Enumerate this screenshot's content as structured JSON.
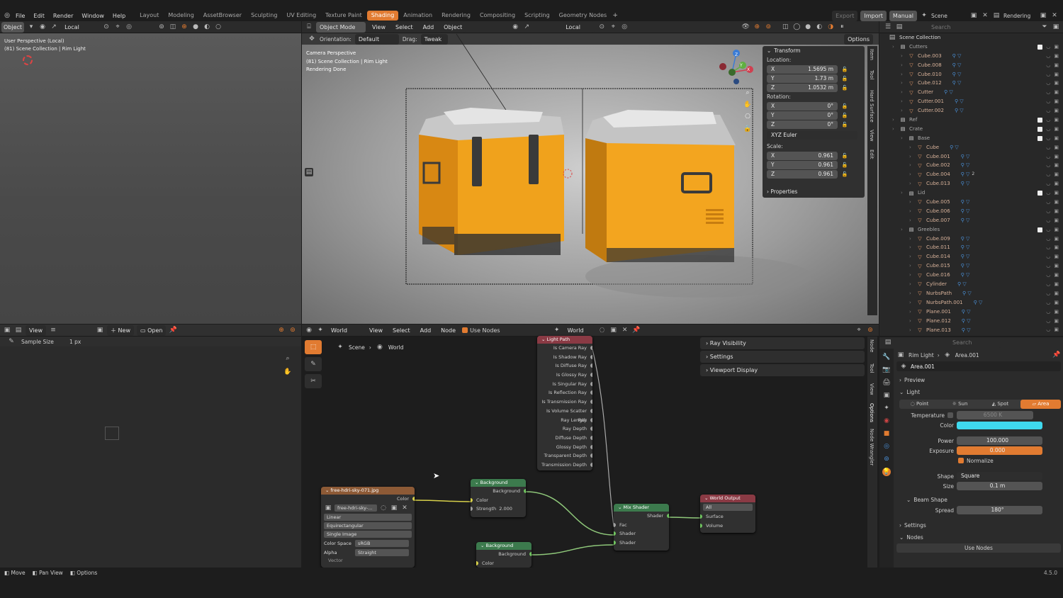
{
  "topbar": {
    "menus": [
      "File",
      "Edit",
      "Render",
      "Window",
      "Help"
    ],
    "workspaces": [
      "Layout",
      "Modeling",
      "AssetBrowser",
      "Sculpting",
      "UV Editing",
      "Texture Paint",
      "Shading",
      "Animation",
      "Rendering",
      "Compositing",
      "Scripting",
      "Geometry Nodes"
    ],
    "active_workspace": "Shading",
    "right": {
      "export": "Export",
      "import": "Import",
      "manual": "Manual",
      "scene": "Scene",
      "view_layer": "Rendering"
    }
  },
  "left_viewport": {
    "header": {
      "mode": "Object",
      "orientation": "Local"
    },
    "overlay_line1": "User Perspective (Local)",
    "overlay_line2": "(81) Scene Collection | Rim Light"
  },
  "main_viewport": {
    "header": {
      "mode": "Object Mode",
      "menus": [
        "View",
        "Select",
        "Add",
        "Object"
      ],
      "orientation": "Local",
      "options": "Options"
    },
    "tool_header": {
      "orientation_label": "Orientation:",
      "orientation_value": "Default",
      "drag_label": "Drag:",
      "drag_value": "Tweak"
    },
    "overlay_line1": "Camera Perspective",
    "overlay_line2": "(81) Scene Collection | Rim Light",
    "overlay_line3": "Rendering Done",
    "side_tabs": [
      "Item",
      "Tool",
      "Hard Surface",
      "View",
      "Edit"
    ],
    "gizmo": {
      "x": "X",
      "y": "Y",
      "z": "Z"
    }
  },
  "transform": {
    "title": "Transform",
    "location_label": "Location:",
    "location": [
      {
        "axis": "X",
        "value": "1.5695 m"
      },
      {
        "axis": "Y",
        "value": "1.73 m"
      },
      {
        "axis": "Z",
        "value": "1.0532 m"
      }
    ],
    "rotation_label": "Rotation:",
    "rotation": [
      {
        "axis": "X",
        "value": "0°"
      },
      {
        "axis": "Y",
        "value": "0°"
      },
      {
        "axis": "Z",
        "value": "0°"
      }
    ],
    "rotation_mode": "XYZ Euler",
    "scale_label": "Scale:",
    "scale": [
      {
        "axis": "X",
        "value": "0.961"
      },
      {
        "axis": "Y",
        "value": "0.961"
      },
      {
        "axis": "Z",
        "value": "0.961"
      }
    ],
    "properties": "Properties"
  },
  "outliner": {
    "search_placeholder": "Search",
    "root": "Scene Collection",
    "rows": [
      {
        "name": "Cutters",
        "type": "coll",
        "indent": 1
      },
      {
        "name": "Cube.003",
        "type": "obj",
        "indent": 2
      },
      {
        "name": "Cube.008",
        "type": "obj",
        "indent": 2
      },
      {
        "name": "Cube.010",
        "type": "obj",
        "indent": 2
      },
      {
        "name": "Cube.012",
        "type": "obj",
        "indent": 2
      },
      {
        "name": "Cutter",
        "type": "obj",
        "indent": 2
      },
      {
        "name": "Cutter.001",
        "type": "obj",
        "indent": 2
      },
      {
        "name": "Cutter.002",
        "type": "obj",
        "indent": 2
      },
      {
        "name": "Ref",
        "type": "ref",
        "indent": 1
      },
      {
        "name": "Crate",
        "type": "coll",
        "indent": 1
      },
      {
        "name": "Base",
        "type": "coll",
        "indent": 2
      },
      {
        "name": "Cube",
        "type": "obj",
        "indent": 3
      },
      {
        "name": "Cube.001",
        "type": "obj",
        "indent": 3
      },
      {
        "name": "Cube.002",
        "type": "obj",
        "indent": 3
      },
      {
        "name": "Cube.004",
        "type": "obj",
        "indent": 3
      },
      {
        "name": "Cube.013",
        "type": "obj",
        "indent": 3
      },
      {
        "name": "Lid",
        "type": "coll",
        "indent": 2
      },
      {
        "name": "Cube.005",
        "type": "obj",
        "indent": 3
      },
      {
        "name": "Cube.006",
        "type": "obj",
        "indent": 3
      },
      {
        "name": "Cube.007",
        "type": "obj",
        "indent": 3
      },
      {
        "name": "Greebles",
        "type": "coll",
        "indent": 2
      },
      {
        "name": "Cube.009",
        "type": "obj",
        "indent": 3
      },
      {
        "name": "Cube.011",
        "type": "obj",
        "indent": 3
      },
      {
        "name": "Cube.014",
        "type": "obj",
        "indent": 3
      },
      {
        "name": "Cube.015",
        "type": "obj",
        "indent": 3
      },
      {
        "name": "Cube.016",
        "type": "obj",
        "indent": 3
      },
      {
        "name": "Cylinder",
        "type": "obj",
        "indent": 3
      },
      {
        "name": "NurbsPath",
        "type": "obj",
        "indent": 3
      },
      {
        "name": "NurbsPath.001",
        "type": "obj",
        "indent": 3
      },
      {
        "name": "Plane.001",
        "type": "obj",
        "indent": 3
      },
      {
        "name": "Plane.012",
        "type": "obj",
        "indent": 3
      },
      {
        "name": "Plane.013",
        "type": "obj",
        "indent": 3
      }
    ],
    "badge_cube004": "2"
  },
  "image_editor": {
    "menus": [
      "View"
    ],
    "new": "New",
    "open": "Open",
    "sample_size_label": "Sample Size",
    "sample_size_value": "1 px"
  },
  "node_editor": {
    "world": "World",
    "menus": [
      "View",
      "Select",
      "Add",
      "Node"
    ],
    "use_nodes": "Use Nodes",
    "world_slot": "World",
    "breadcrumb_scene": "Scene",
    "breadcrumb_world": "World",
    "side_panels": [
      "Ray Visibility",
      "Settings",
      "Viewport Display"
    ],
    "side_tabs": [
      "Node",
      "Tool",
      "View",
      "Options",
      "Node Wrangler"
    ]
  },
  "nodes": {
    "light_path": {
      "title": "Light Path",
      "outputs": [
        "Is Camera Ray",
        "Is Shadow Ray",
        "Is Diffuse Ray",
        "Is Glossy Ray",
        "Is Singular Ray",
        "Is Reflection Ray",
        "Is Transmission Ray",
        "Is Volume Scatter Ray",
        "Ray Length",
        "Ray Depth",
        "Diffuse Depth",
        "Glossy Depth",
        "Transparent Depth",
        "Transmission Depth"
      ]
    },
    "image_tex": {
      "title": "free-hdri-sky-071.jpg",
      "out_color": "Color",
      "image_name": "free-hdri-sky-...",
      "interp": "Linear",
      "projection": "Equirectangular",
      "source": "Single Image",
      "color_space_label": "Color Space",
      "color_space": "sRGB",
      "alpha_label": "Alpha",
      "alpha": "Straight",
      "vector": "Vector"
    },
    "background1": {
      "title": "Background",
      "out": "Background",
      "color": "Color",
      "strength_label": "Strength",
      "strength": "2.000"
    },
    "background2": {
      "title": "Background",
      "out": "Background",
      "color": "Color"
    },
    "mix_shader": {
      "title": "Mix Shader",
      "out": "Shader",
      "fac": "Fac",
      "shader1": "Shader",
      "shader2": "Shader"
    },
    "world_output": {
      "title": "World Output",
      "target": "All",
      "surface": "Surface",
      "volume": "Volume"
    }
  },
  "properties": {
    "search_placeholder": "Search",
    "crumb_obj": "Rim Light",
    "crumb_data": "Area.001",
    "datablock": "Area.001",
    "preview": "Preview",
    "light": "Light",
    "types": [
      "Point",
      "Sun",
      "Spot",
      "Area"
    ],
    "active_type": "Area",
    "temperature_label": "Temperature",
    "temperature": "6500 K",
    "color_label": "Color",
    "light_color": "#3fd9ee",
    "power_label": "Power",
    "power": "100.000",
    "exposure_label": "Exposure",
    "exposure": "0.000",
    "normalize": "Normalize",
    "shape_label": "Shape",
    "shape": "Square",
    "size_label": "Size",
    "size": "0.1 m",
    "beam_shape": "Beam Shape",
    "spread_label": "Spread",
    "spread": "180°",
    "settings": "Settings",
    "nodes": "Nodes",
    "use_nodes": "Use Nodes"
  },
  "statusbar": {
    "items": [
      "Move",
      "Pan View",
      "Options"
    ],
    "version": "4.5.0"
  },
  "colors": {
    "accent": "#e17b31",
    "crate": "#f0a21c",
    "crate_dark": "#b66a0c",
    "node_green": "#3c7a4d",
    "node_red": "#8a3a44",
    "node_orange": "#8d5a36",
    "link": "#8fc87a"
  }
}
